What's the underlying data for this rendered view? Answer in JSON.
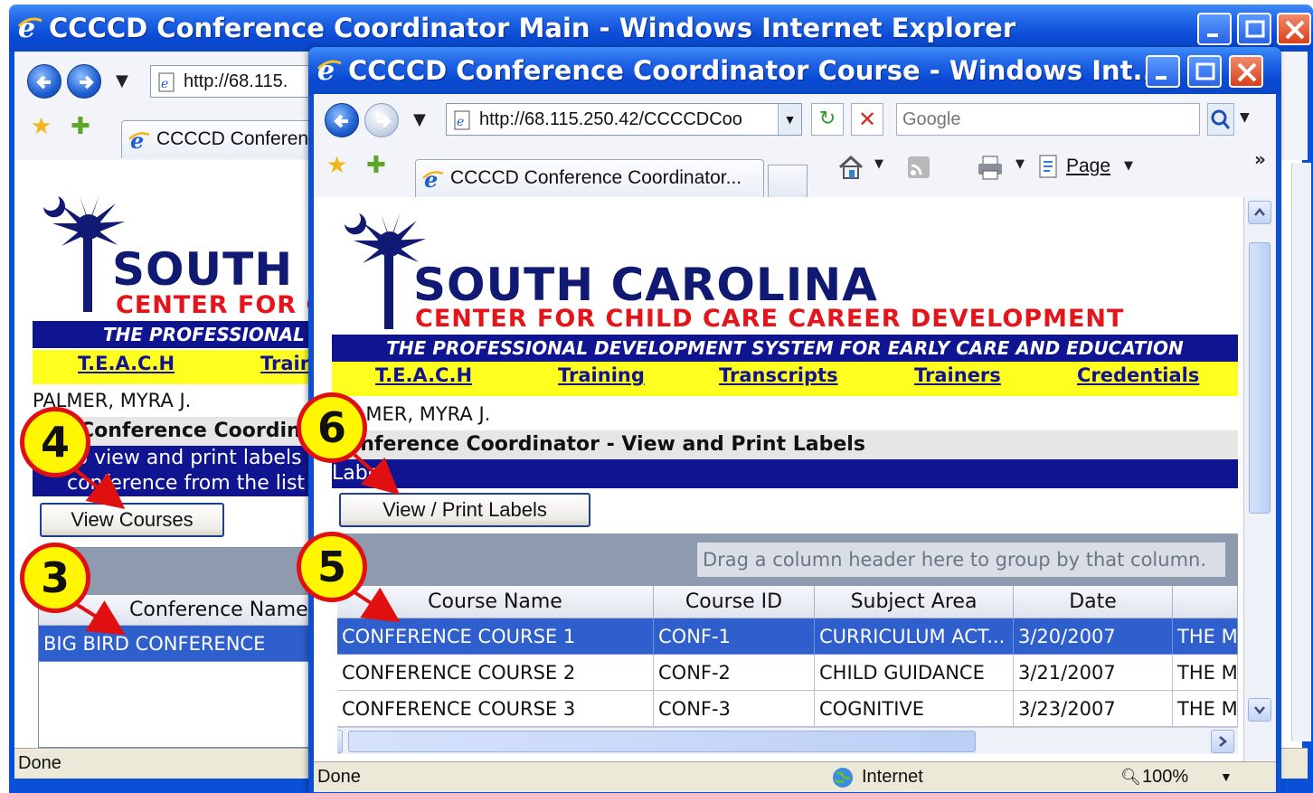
{
  "back_window": {
    "title": "CCCCD Conference Coordinator Main - Windows Internet Explorer",
    "address": "http://68.115.",
    "tab_label": "CCCCD Conferenc",
    "status": "Done",
    "site": {
      "title": "SOUTH",
      "subtitle": "CENTER FOR C",
      "banner": "THE PROFESSIONAL D",
      "nav": [
        "T.E.A.C.H",
        "Train"
      ],
      "user": "PALMER, MYRA J.",
      "section_title": "Conference Coordinator",
      "desc_line1": "To view and print labels",
      "desc_line2": "conference from the list",
      "button": "View Courses",
      "grid_header": "Conference Name",
      "grid_row": "BIG BIRD CONFERENCE"
    }
  },
  "front_window": {
    "title": "CCCCD Conference Coordinator Course - Windows Int...",
    "address": "http://68.115.250.42/CCCCDCoo",
    "search_placeholder": "Google",
    "tab_label": "CCCCD Conference Coordinator...",
    "page_menu": "Page",
    "status": "Done",
    "zone": "Internet",
    "zoom": "100%",
    "site": {
      "title": "SOUTH CAROLINA",
      "subtitle": "CENTER FOR CHILD CARE CAREER DEVELOPMENT",
      "banner": "THE PROFESSIONAL DEVELOPMENT SYSTEM FOR EARLY CARE AND EDUCATION",
      "nav": [
        "T.E.A.C.H",
        "Training",
        "Transcripts",
        "Trainers",
        "Credentials"
      ],
      "user": "PALMER, MYRA J.",
      "section_title": "Conference Coordinator - View and Print Labels",
      "label_bar": "Label",
      "button": "View / Print Labels",
      "group_hint": "Drag a column header here to group by that column.",
      "columns": [
        "Course Name",
        "Course ID",
        "Subject Area",
        "Date",
        ""
      ],
      "rows": [
        [
          "CONFERENCE COURSE 1",
          "CONF-1",
          "CURRICULUM ACT...",
          "3/20/2007",
          "THE M"
        ],
        [
          "CONFERENCE COURSE 2",
          "CONF-2",
          "CHILD GUIDANCE",
          "3/21/2007",
          "THE M"
        ],
        [
          "CONFERENCE COURSE 3",
          "CONF-3",
          "COGNITIVE",
          "3/23/2007",
          "THE M"
        ]
      ]
    }
  },
  "callouts": [
    "4",
    "3",
    "6",
    "5"
  ],
  "colors": {
    "accent": "#e01010",
    "callout_fill": "#fff600",
    "navy": "#0f1590",
    "site_red": "#e3141a",
    "yellow": "#ffff1f",
    "selected_row": "#2f5fcc"
  }
}
